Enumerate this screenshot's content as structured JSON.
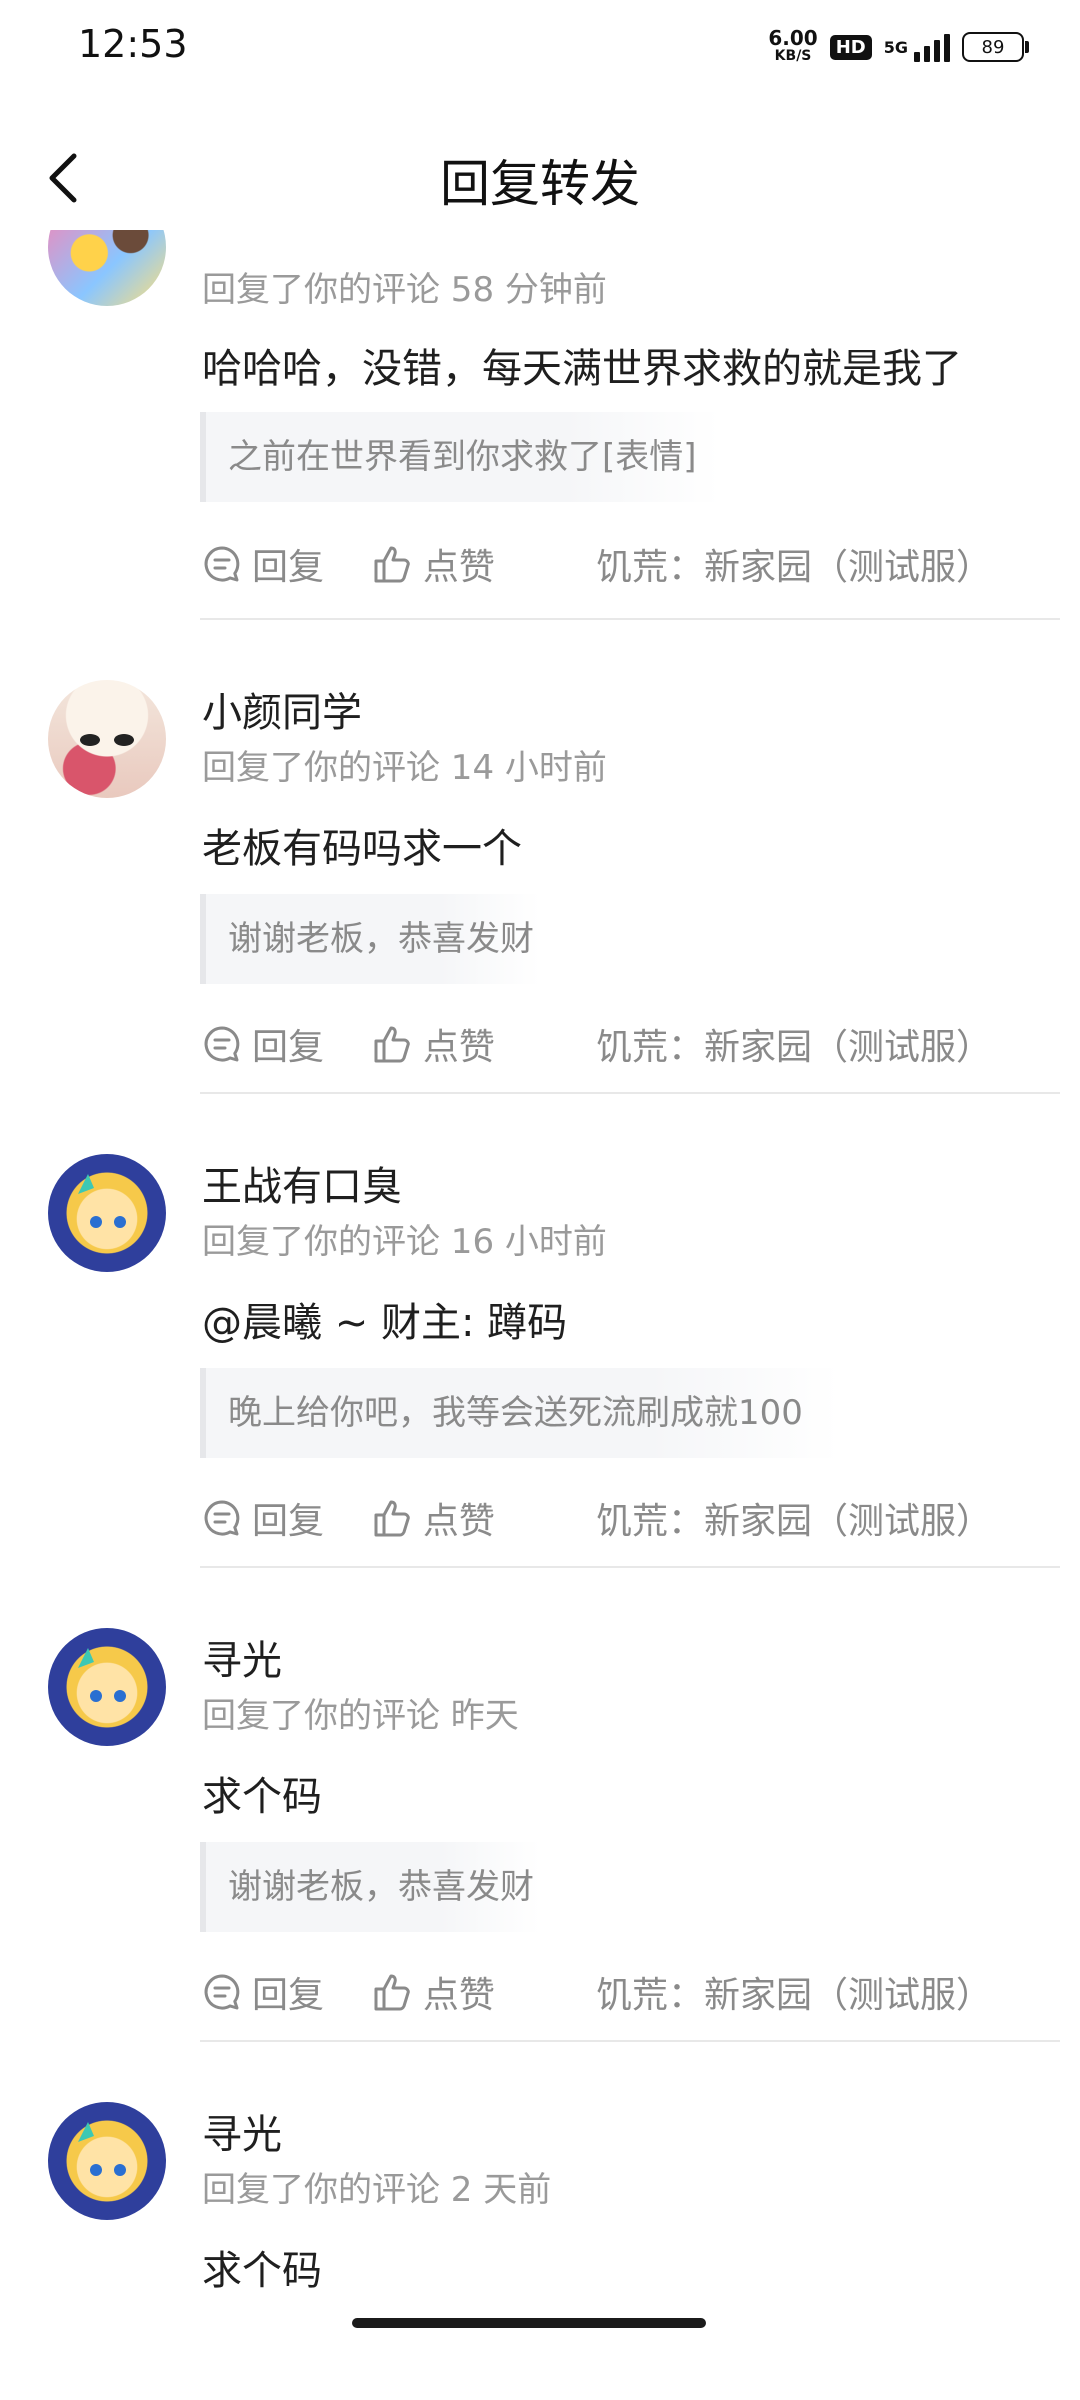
{
  "status": {
    "time": "12:53",
    "net_speed": "6.00",
    "net_unit": "KB/S",
    "hd": "HD",
    "network": "5G",
    "battery": "89"
  },
  "header": {
    "title": "回复转发"
  },
  "actions": {
    "reply": "回复",
    "like": "点赞"
  },
  "items": [
    {
      "name": "",
      "meta": "回复了你的评论 58 分钟前",
      "content": "哈哈哈，没错，每天满世界求救的就是我了",
      "quote": "之前在世界看到你求救了[表情]",
      "game": "饥荒：新家园（测试服）"
    },
    {
      "name": "小颜同学",
      "meta": "回复了你的评论 14 小时前",
      "content": "老板有码吗求一个",
      "quote": "谢谢老板，恭喜发财",
      "game": "饥荒：新家园（测试服）"
    },
    {
      "name": "王战有口臭",
      "meta": "回复了你的评论 16 小时前",
      "content": "@晨曦 ~ 财主: 蹲码",
      "quote": "晚上给你吧，我等会送死流刷成就100",
      "game": "饥荒：新家园（测试服）"
    },
    {
      "name": "寻光",
      "meta": "回复了你的评论 昨天",
      "content": "求个码",
      "quote": "谢谢老板，恭喜发财",
      "game": "饥荒：新家园（测试服）"
    },
    {
      "name": "寻光",
      "meta": "回复了你的评论 2 天前",
      "content": "求个码"
    }
  ]
}
